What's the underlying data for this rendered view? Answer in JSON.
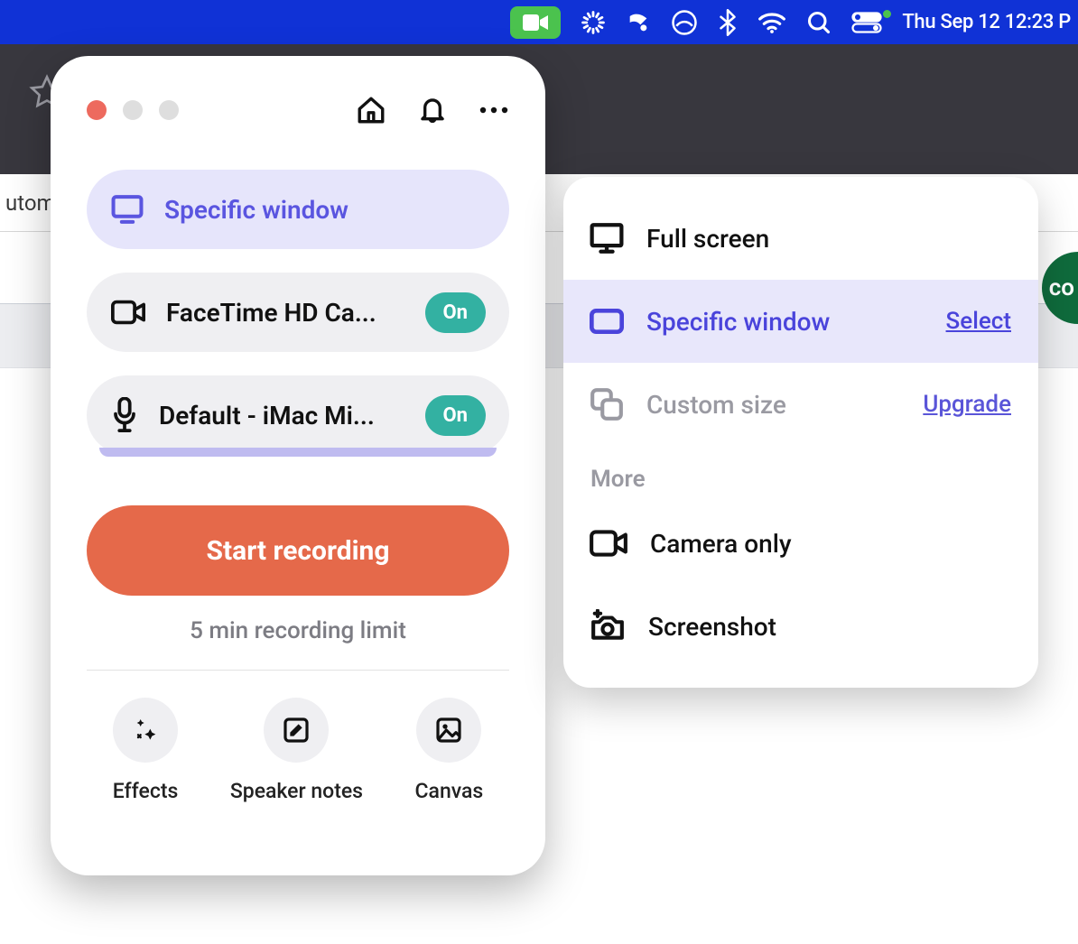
{
  "menubar": {
    "datetime": "Thu Sep 12  12:23 P"
  },
  "background": {
    "bookmark_fragment": "utoma"
  },
  "recorder": {
    "mode_label": "Specific window",
    "camera": {
      "label": "FaceTime HD Ca...",
      "state": "On"
    },
    "mic": {
      "label": "Default - iMac Mi...",
      "state": "On"
    },
    "start_label": "Start recording",
    "limit_text": "5 min recording limit",
    "tools": {
      "effects": "Effects",
      "notes": "Speaker notes",
      "canvas": "Canvas"
    }
  },
  "dropdown": {
    "full_screen": "Full screen",
    "specific_window": "Specific window",
    "specific_window_action": "Select",
    "custom_size": "Custom size",
    "custom_size_action": "Upgrade",
    "more_label": "More",
    "camera_only": "Camera only",
    "screenshot": "Screenshot"
  }
}
